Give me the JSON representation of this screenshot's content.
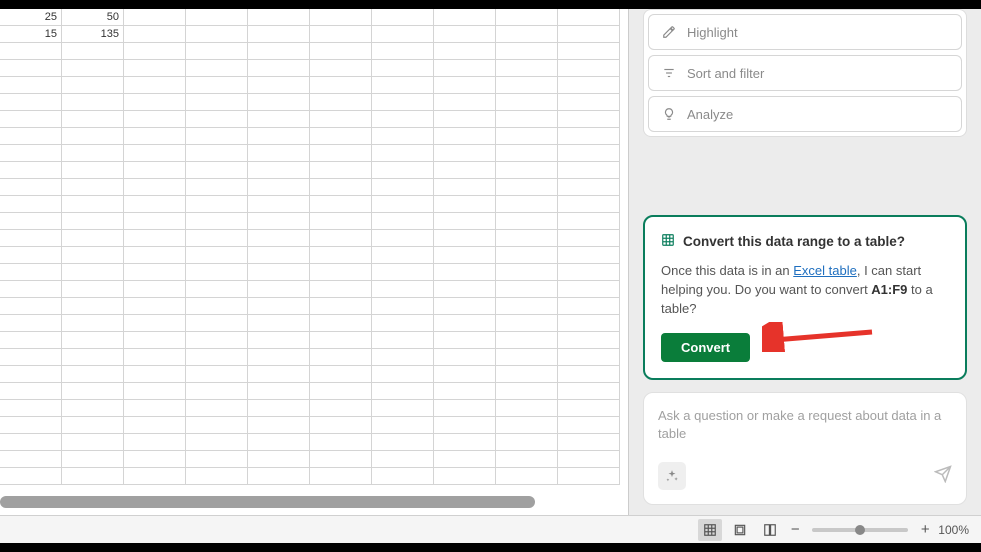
{
  "sheet": {
    "rows": [
      {
        "a": "25",
        "b": "50"
      },
      {
        "a": "15",
        "b": "135"
      }
    ]
  },
  "actions": {
    "highlight": "Highlight",
    "sort_filter": "Sort and filter",
    "analyze": "Analyze"
  },
  "convert": {
    "title": "Convert this data range to a table?",
    "body_pre": "Once this data is in an ",
    "link_text": "Excel table",
    "body_mid": ", I can start helping you. Do you want to convert ",
    "range": "A1:F9",
    "body_post": " to a table?",
    "button": "Convert"
  },
  "chat": {
    "placeholder": "Ask a question or make a request about data in a table"
  },
  "status": {
    "zoom": "100%"
  }
}
